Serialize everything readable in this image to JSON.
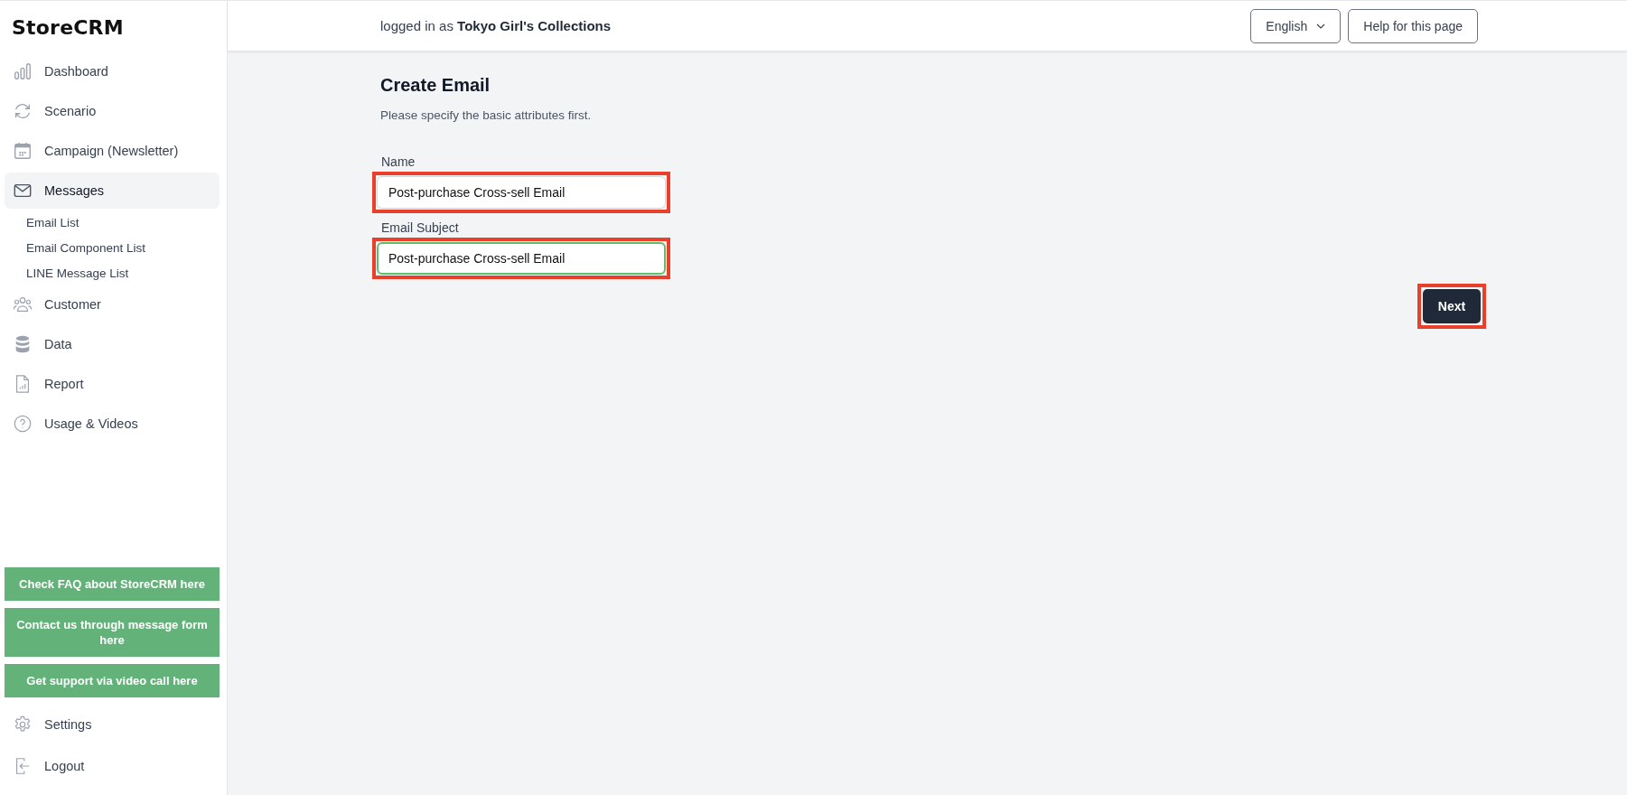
{
  "sidebar": {
    "logo": "StoreCRM",
    "items": [
      {
        "label": "Dashboard",
        "kind": "chart",
        "selected": false
      },
      {
        "label": "Scenario",
        "kind": "cycle",
        "selected": false
      },
      {
        "label": "Campaign (Newsletter)",
        "kind": "calendar",
        "selected": false
      },
      {
        "label": "Messages",
        "kind": "mail",
        "selected": true,
        "children": [
          {
            "label": "Email List"
          },
          {
            "label": "Email Component List"
          },
          {
            "label": "LINE Message List"
          }
        ]
      },
      {
        "label": "Customer",
        "kind": "people",
        "selected": false
      },
      {
        "label": "Data",
        "kind": "database",
        "selected": false
      },
      {
        "label": "Report",
        "kind": "report",
        "selected": false
      },
      {
        "label": "Usage & Videos",
        "kind": "help",
        "selected": false
      }
    ],
    "support_buttons": [
      "Check FAQ about StoreCRM here",
      "Contact us through message form here",
      "Get support via video call here"
    ],
    "bottom_items": [
      {
        "label": "Settings",
        "kind": "gear"
      },
      {
        "label": "Logout",
        "kind": "logout"
      }
    ]
  },
  "header": {
    "logged_in_prefix": "logged in as",
    "account": "Tokyo Girl's Collections",
    "language": "English",
    "help_button": "Help for this page"
  },
  "form": {
    "title": "Create Email",
    "subtitle": "Please specify the basic attributes first.",
    "fields": [
      {
        "label": "Name",
        "value": "Post-purchase Cross-sell Email",
        "focused": false,
        "highlighted": true
      },
      {
        "label": "Email Subject",
        "value": "Post-purchase Cross-sell Email",
        "focused": true,
        "highlighted": true
      }
    ],
    "next_button": {
      "label": "Next",
      "highlighted": true
    }
  }
}
